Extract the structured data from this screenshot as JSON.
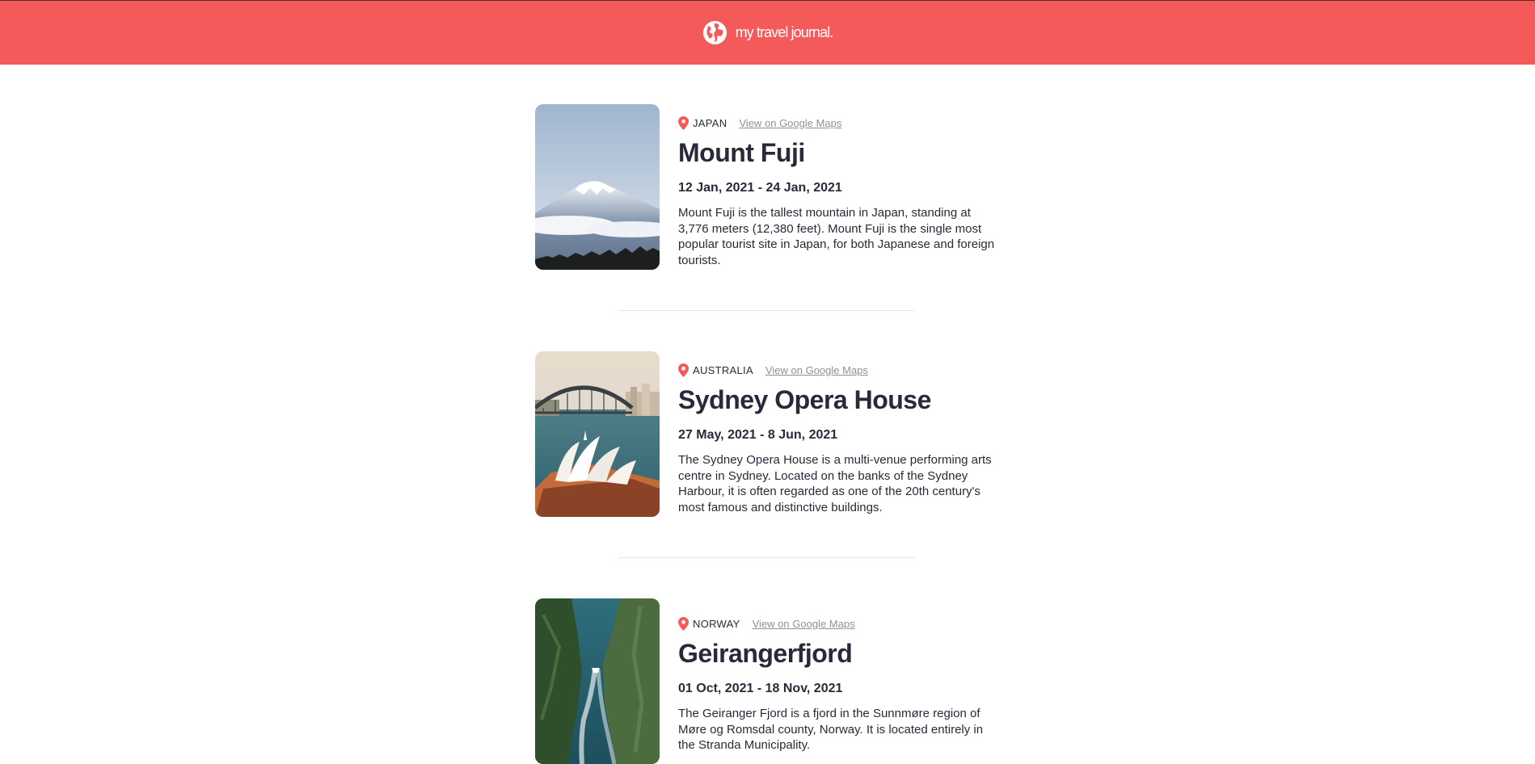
{
  "header": {
    "brand": "my travel journal.",
    "icon": "globe-icon",
    "color": "#F55A5A"
  },
  "entries": [
    {
      "image": "mount-fuji-photo",
      "location": "JAPAN",
      "maps_link": "View on Google Maps",
      "title": "Mount Fuji",
      "dates": "12 Jan, 2021 - 24 Jan, 2021",
      "description": "Mount Fuji is the tallest mountain in Japan, standing at 3,776 meters (12,380 feet). Mount Fuji is the single most popular tourist site in Japan, for both Japanese and foreign tourists."
    },
    {
      "image": "sydney-opera-house-photo",
      "location": "AUSTRALIA",
      "maps_link": "View on Google Maps",
      "title": "Sydney Opera House",
      "dates": "27 May, 2021 - 8 Jun, 2021",
      "description": "The Sydney Opera House is a multi-venue performing arts centre in Sydney. Located on the banks of the Sydney Harbour, it is often regarded as one of the 20th century's most famous and distinctive buildings."
    },
    {
      "image": "geirangerfjord-photo",
      "location": "NORWAY",
      "maps_link": "View on Google Maps",
      "title": "Geirangerfjord",
      "dates": "01 Oct, 2021 - 18 Nov, 2021",
      "description": "The Geiranger Fjord is a fjord in the Sunnmøre region of Møre og Romsdal county, Norway. It is located entirely in the Stranda Municipality."
    }
  ],
  "colors": {
    "accent": "#F55A5A",
    "text": "#2B283A",
    "link": "#918E9B",
    "divider": "#E5E5E5"
  }
}
